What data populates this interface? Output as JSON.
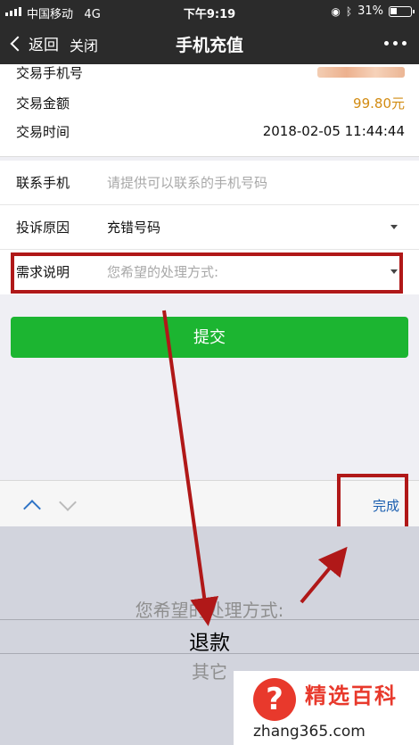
{
  "status_bar": {
    "carrier": "中国移动",
    "network": "4G",
    "time": "下午9:19",
    "battery": "31%"
  },
  "nav": {
    "back_label": "返回",
    "close_label": "关闭",
    "title": "手机充值"
  },
  "transaction": {
    "phone_label": "交易手机号",
    "amount_label": "交易金额",
    "amount_value": "99.80元",
    "time_label": "交易时间",
    "time_value": "2018-02-05 11:44:44"
  },
  "form": {
    "contact_label": "联系手机",
    "contact_placeholder": "请提供可以联系的手机号码",
    "reason_label": "投诉原因",
    "reason_value": "充错号码",
    "desc_label": "需求说明",
    "desc_placeholder": "您希望的处理方式:"
  },
  "submit_label": "提交",
  "picker": {
    "done_label": "完成",
    "options": [
      "您希望的处理方式:",
      "退款",
      "其它"
    ],
    "selected": "退款"
  },
  "watermark": {
    "title": "精选百科",
    "url": "zhang365.com"
  },
  "colors": {
    "accent_green": "#1cb531",
    "amount_orange": "#d28b12",
    "annotation_red": "#b01818",
    "done_blue": "#1b5fb0"
  }
}
